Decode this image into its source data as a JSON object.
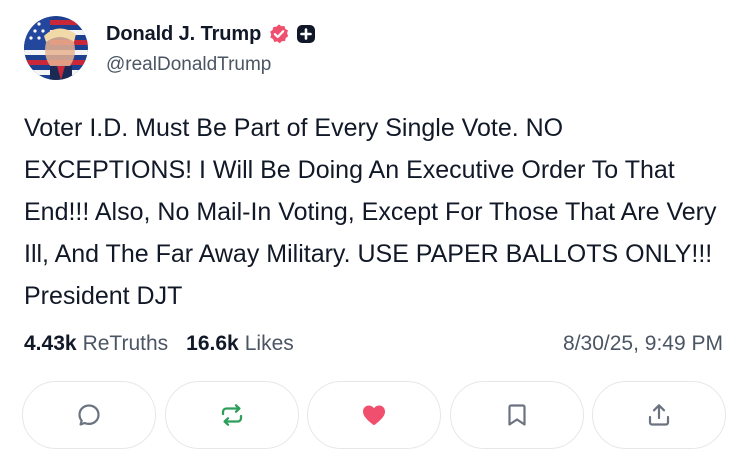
{
  "author": {
    "display_name": "Donald J. Trump",
    "handle": "@realDonaldTrump",
    "avatar_icon": "avatar-image",
    "verified_badge_icon": "verified-badge-icon",
    "verified_badge_color": "#f0506e",
    "plus_badge_icon": "plus-badge-icon"
  },
  "post": {
    "text": "Voter I.D. Must Be Part of Every Single Vote. NO EXCEPTIONS! I Will Be Doing An Executive Order To That End!!! Also, No Mail-In Voting, Except For Those That Are Very Ill, And The Far Away Military. USE PAPER BALLOTS ONLY!!! President DJT"
  },
  "stats": {
    "retruths_count": "4.43k",
    "retruths_label": "ReTruths",
    "likes_count": "16.6k",
    "likes_label": "Likes",
    "timestamp": "8/30/25, 9:49 PM"
  },
  "actions": [
    {
      "name": "reply",
      "icon": "reply-icon",
      "color": "#6b7280"
    },
    {
      "name": "retruth",
      "icon": "retruth-icon",
      "color": "#2e9e5b"
    },
    {
      "name": "like",
      "icon": "heart-icon",
      "color": "#f0506e"
    },
    {
      "name": "bookmark",
      "icon": "bookmark-icon",
      "color": "#6b7280"
    },
    {
      "name": "share",
      "icon": "share-icon",
      "color": "#6b7280"
    }
  ]
}
